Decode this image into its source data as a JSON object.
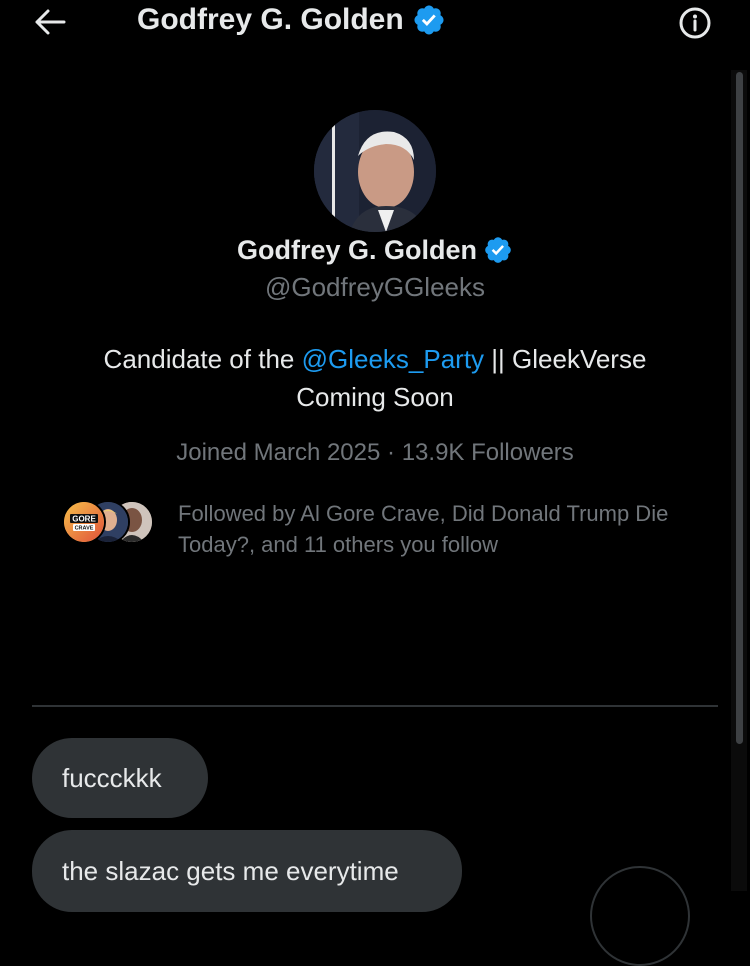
{
  "header": {
    "title": "Godfrey G. Golden",
    "back_icon": "arrow-left-icon",
    "info_icon": "info-icon",
    "verified_icon": "verified-badge-icon"
  },
  "profile": {
    "name": "Godfrey G. Golden",
    "handle": "@GodfreyGGleeks",
    "bio_prefix": "Candidate of the ",
    "bio_mention": "@Gleeks_Party",
    "bio_suffix": " || GleekVerse Coming Soon",
    "joined": "Joined March 2025",
    "separator": "·",
    "followers": "13.9K Followers",
    "followed_by": "Followed by Al Gore Crave, Did Donald Trump Die Today?, and 11 others you follow",
    "followed_avatar_logo_text_top": "GORE",
    "followed_avatar_logo_text_bottom": "CRAVE"
  },
  "messages": [
    {
      "text": "fuccckkk"
    },
    {
      "text": "the slazac gets me everytime"
    }
  ],
  "colors": {
    "background": "#000000",
    "text": "#e7e9ea",
    "secondary": "#71767b",
    "accent": "#1d9bf0",
    "bubble": "#2f3336"
  }
}
